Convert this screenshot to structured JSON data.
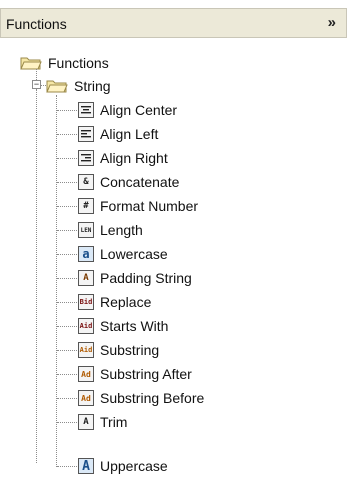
{
  "panel": {
    "title": "Functions",
    "collapse_icon": "double-chevron-down-icon"
  },
  "tree": {
    "root": {
      "label": "Functions",
      "icon": "folder-open-icon"
    },
    "group": {
      "label": "String",
      "icon": "folder-open-icon",
      "expanded": true
    },
    "items": [
      {
        "label": "Align Center",
        "icon": "align-center-icon",
        "glyph": ""
      },
      {
        "label": "Align Left",
        "icon": "align-left-icon",
        "glyph": ""
      },
      {
        "label": "Align Right",
        "icon": "align-right-icon",
        "glyph": ""
      },
      {
        "label": "Concatenate",
        "icon": "concatenate-icon",
        "glyph": "&"
      },
      {
        "label": "Format Number",
        "icon": "format-number-icon",
        "glyph": "#"
      },
      {
        "label": "Length",
        "icon": "length-icon",
        "glyph": "LEN"
      },
      {
        "label": "Lowercase",
        "icon": "lowercase-icon",
        "glyph": "a"
      },
      {
        "label": "Padding String",
        "icon": "padding-string-icon",
        "glyph": "A"
      },
      {
        "label": "Replace",
        "icon": "replace-icon",
        "glyph": "Bid"
      },
      {
        "label": "Starts With",
        "icon": "starts-with-icon",
        "glyph": "Aid"
      },
      {
        "label": "Substring",
        "icon": "substring-icon",
        "glyph": "Aid"
      },
      {
        "label": "Substring After",
        "icon": "substring-after-icon",
        "glyph": "Ad"
      },
      {
        "label": "Substring Before",
        "icon": "substring-before-icon",
        "glyph": "Ad"
      },
      {
        "label": "Trim",
        "icon": "trim-icon",
        "glyph": "A"
      },
      {
        "label": "Uppercase",
        "icon": "uppercase-icon",
        "glyph": "A"
      }
    ]
  }
}
